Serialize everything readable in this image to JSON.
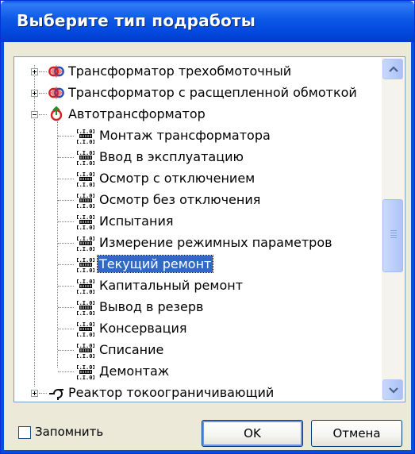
{
  "dialog": {
    "title": "Выберите тип подработы"
  },
  "tree": {
    "items": [
      {
        "label": "Трансформатор трехобмоточный",
        "level": 0,
        "expander": "plus",
        "icon": "transformer-icon"
      },
      {
        "label": "Трансформатор с расщепленной обмоткой",
        "level": 0,
        "expander": "plus",
        "icon": "transformer-icon"
      },
      {
        "label": "Автотрансформатор",
        "level": 0,
        "expander": "minus",
        "icon": "autotransformer-icon"
      },
      {
        "label": "Монтаж трансформатора",
        "level": 1,
        "icon": "numeric-data-icon"
      },
      {
        "label": "Ввод в эксплуатацию",
        "level": 1,
        "icon": "numeric-data-icon"
      },
      {
        "label": "Осмотр с отключением",
        "level": 1,
        "icon": "numeric-data-icon"
      },
      {
        "label": "Осмотр без отключения",
        "level": 1,
        "icon": "numeric-data-icon"
      },
      {
        "label": "Испытания",
        "level": 1,
        "icon": "numeric-data-icon"
      },
      {
        "label": "Измерение режимных параметров",
        "level": 1,
        "icon": "numeric-data-icon"
      },
      {
        "label": "Текущий ремонт",
        "level": 1,
        "icon": "numeric-data-icon",
        "selected": true
      },
      {
        "label": "Капитальный ремонт",
        "level": 1,
        "icon": "numeric-data-icon"
      },
      {
        "label": "Вывод в резерв",
        "level": 1,
        "icon": "numeric-data-icon"
      },
      {
        "label": "Консервация",
        "level": 1,
        "icon": "numeric-data-icon"
      },
      {
        "label": "Списание",
        "level": 1,
        "icon": "numeric-data-icon"
      },
      {
        "label": "Демонтаж",
        "level": 1,
        "icon": "numeric-data-icon"
      },
      {
        "label": "Реактор токоограничивающий",
        "level": 0,
        "expander": "plus",
        "icon": "reactor-icon"
      }
    ],
    "icon_text": "I.I.01"
  },
  "footer": {
    "remember_label": "Запомнить",
    "remember_checked": false,
    "ok_label": "OK",
    "cancel_label": "Отмена"
  },
  "colors": {
    "title_bar": "#0a5ae8",
    "selection": "#316ac5",
    "window_face": "#ece9d8"
  }
}
